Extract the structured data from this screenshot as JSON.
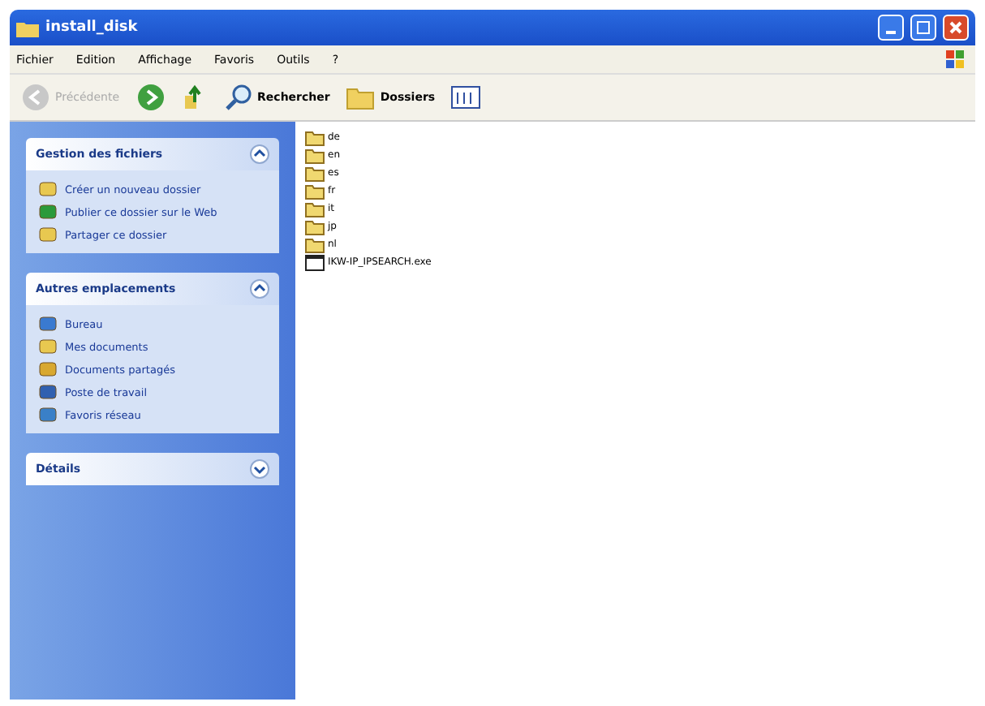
{
  "window": {
    "title": "install_disk"
  },
  "menu": [
    "Fichier",
    "Edition",
    "Affichage",
    "Favoris",
    "Outils",
    "?"
  ],
  "toolbar": [
    {
      "kind": "back",
      "label": "Précédente",
      "disabled": true
    },
    {
      "kind": "forward",
      "disabled": false
    },
    {
      "kind": "up",
      "disabled": false
    },
    {
      "kind": "search",
      "label": "Rechercher",
      "disabled": false
    },
    {
      "kind": "folders",
      "label": "Dossiers",
      "disabled": false
    },
    {
      "kind": "views",
      "disabled": false
    }
  ],
  "panels": [
    {
      "title": "Gestion des fichiers",
      "expanded": true,
      "items": [
        {
          "kind": "newfolder",
          "label": "Créer un nouveau dossier"
        },
        {
          "kind": "web",
          "label": "Publier ce dossier sur le Web"
        },
        {
          "kind": "share",
          "label": "Partager ce dossier"
        }
      ]
    },
    {
      "title": "Autres emplacements",
      "expanded": true,
      "items": [
        {
          "kind": "desktop",
          "label": "Bureau"
        },
        {
          "kind": "docs",
          "label": "Mes documents"
        },
        {
          "kind": "shared",
          "label": "Documents partagés"
        },
        {
          "kind": "computer",
          "label": "Poste de travail"
        },
        {
          "kind": "network",
          "label": "Favoris réseau"
        }
      ]
    },
    {
      "title": "Détails",
      "expanded": false
    }
  ],
  "files": [
    {
      "kind": "folder",
      "name": "de"
    },
    {
      "kind": "folder",
      "name": "en"
    },
    {
      "kind": "folder",
      "name": "es"
    },
    {
      "kind": "folder",
      "name": "fr"
    },
    {
      "kind": "folder",
      "name": "it"
    },
    {
      "kind": "folder",
      "name": "jp"
    },
    {
      "kind": "folder",
      "name": "nl"
    },
    {
      "kind": "exe",
      "name": "IKW-IP_IPSEARCH.exe"
    }
  ]
}
